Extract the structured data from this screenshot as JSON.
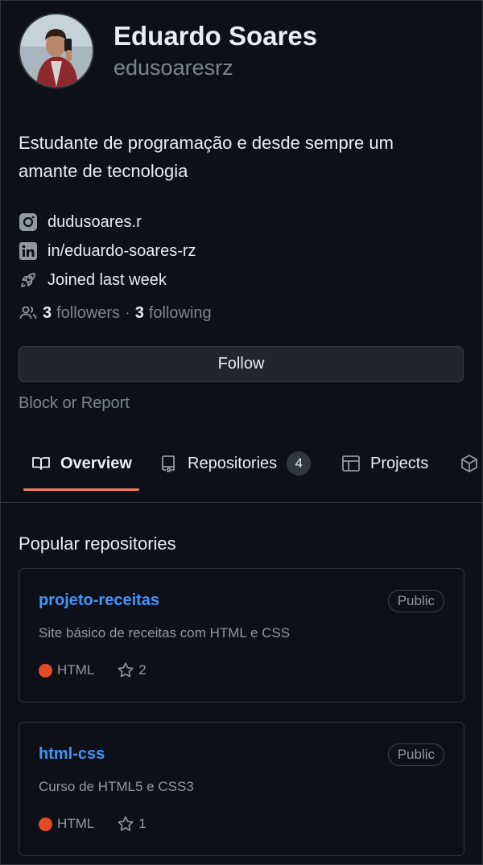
{
  "profile": {
    "full_name": "Eduardo Soares",
    "username": "edusoaresrz",
    "bio": "Estudante de programação e desde sempre um amante de tecnologia",
    "links": [
      {
        "icon": "instagram-icon",
        "text": "dudusoares.r"
      },
      {
        "icon": "linkedin-icon",
        "text": "in/eduardo-soares-rz"
      },
      {
        "icon": "rocket-icon",
        "text": "Joined last week"
      }
    ],
    "followers_count": "3",
    "followers_label": "followers",
    "separator": "·",
    "following_count": "3",
    "following_label": "following",
    "follow_button": "Follow",
    "block_link": "Block or Report"
  },
  "tabs": [
    {
      "label": "Overview",
      "icon": "book-icon",
      "active": true
    },
    {
      "label": "Repositories",
      "icon": "repo-icon",
      "counter": "4"
    },
    {
      "label": "Projects",
      "icon": "table-icon"
    },
    {
      "label": "",
      "icon": "package-icon"
    }
  ],
  "popular": {
    "title": "Popular repositories",
    "repos": [
      {
        "name": "projeto-receitas",
        "visibility": "Public",
        "description": "Site básico de receitas com HTML e CSS",
        "language": "HTML",
        "language_color": "#e34c26",
        "stars": "2"
      },
      {
        "name": "html-css",
        "visibility": "Public",
        "description": "Curso de HTML5 e CSS3",
        "language": "HTML",
        "language_color": "#e34c26",
        "stars": "1"
      }
    ]
  },
  "colors": {
    "background": "#0d1117",
    "link": "#4493f8",
    "active_tab_underline": "#f78166"
  }
}
